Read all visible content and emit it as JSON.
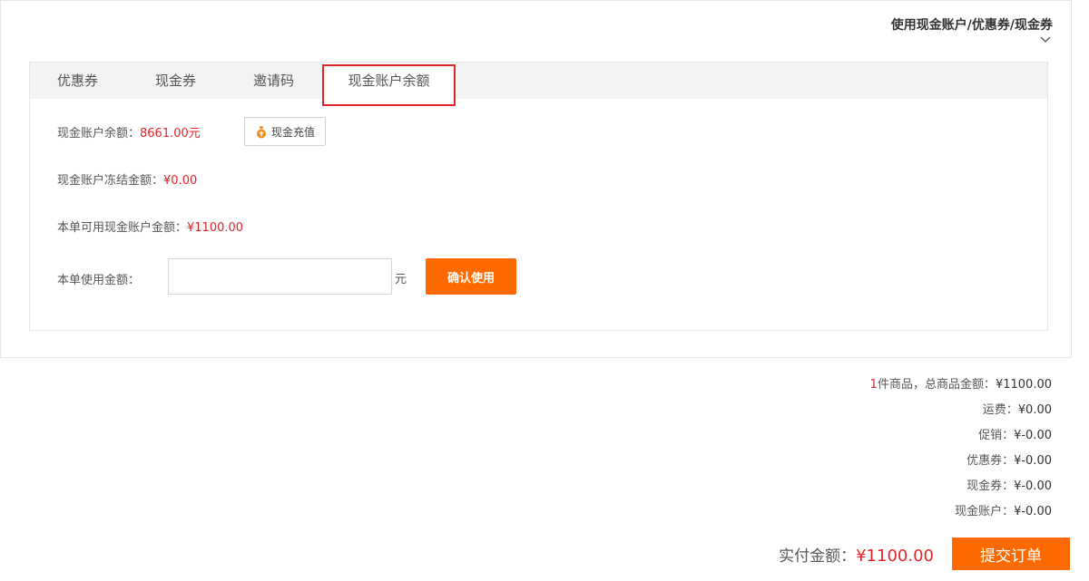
{
  "panel": {
    "title": "使用现金账户/优惠券/现金券"
  },
  "tabs": [
    {
      "label": "优惠券"
    },
    {
      "label": "现金券"
    },
    {
      "label": "邀请码"
    },
    {
      "label": "现金账户余额",
      "active": true
    }
  ],
  "account": {
    "balance_label": "现金账户余额：",
    "balance_value": "8661.00元",
    "recharge_label": "现金充值",
    "frozen_label": "现金账户冻结金额：",
    "frozen_value": "¥0.00",
    "available_label": "本单可用现金账户金额：",
    "available_value": "¥1100.00",
    "use_label": "本单使用金额：",
    "use_input_value": "",
    "unit": "元",
    "confirm_label": "确认使用"
  },
  "summary": {
    "item_count": "1",
    "item_text": "件商品，总商品金额：",
    "item_value": "¥1100.00",
    "shipping_label": "运费：",
    "shipping_value": "¥0.00",
    "promo_label": "促销：",
    "promo_value": "¥-0.00",
    "coupon_label": "优惠券：",
    "coupon_value": "¥-0.00",
    "cash_coupon_label": "现金券：",
    "cash_coupon_value": "¥-0.00",
    "cash_account_label": "现金账户：",
    "cash_account_value": "¥-0.00",
    "pay_label": "实付金额：",
    "pay_value": "¥1100.00",
    "submit_label": "提交订单"
  },
  "colors": {
    "accent": "#ff6a00",
    "price_red": "#e0262a"
  },
  "icons": [
    "chevron-down-icon",
    "coin-bag-icon"
  ]
}
